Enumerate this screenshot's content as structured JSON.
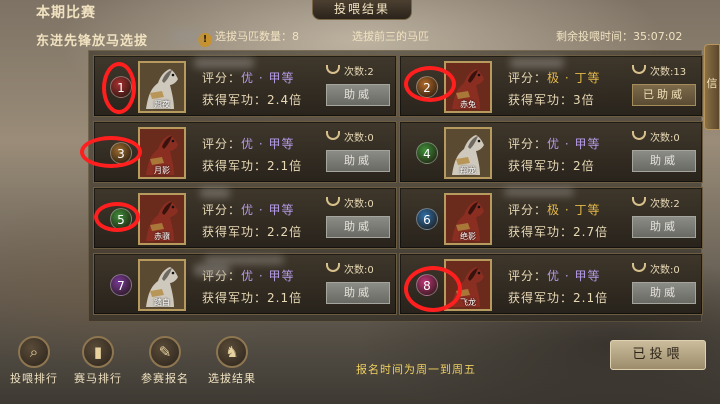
{
  "header": {
    "period_title": "本期比赛",
    "event_name": "东进先锋放马选拔",
    "tab_title": "投喂结果",
    "select_count_label": "选拔马匹数量：8",
    "select_top_label": "选拔前三的马匹",
    "remaining_label": "剩余投喂时间：35:07:02"
  },
  "cards": [
    {
      "rank": "1",
      "horse": "照夜",
      "rating_label": "评分：",
      "grade_a": "优",
      "grade_b": "甲等",
      "merit_label": "获得军功：",
      "merit": "2.4倍",
      "count": "次数:2",
      "button": "助威",
      "done": false,
      "badge_color": "#a83030"
    },
    {
      "rank": "2",
      "horse": "赤兔",
      "rating_label": "评分：",
      "grade_a": "极",
      "grade_b": "丁等",
      "merit_label": "获得军功：",
      "merit": "3倍",
      "count": "次数:13",
      "button": "已助威",
      "done": true,
      "badge_color": "#b36a2a"
    },
    {
      "rank": "3",
      "horse": "月影",
      "rating_label": "评分：",
      "grade_a": "优",
      "grade_b": "甲等",
      "merit_label": "获得军功：",
      "merit": "2.1倍",
      "count": "次数:0",
      "button": "助威",
      "done": false,
      "badge_color": "#9a6a2e"
    },
    {
      "rank": "4",
      "horse": "翔龙",
      "rating_label": "评分：",
      "grade_a": "优",
      "grade_b": "甲等",
      "merit_label": "获得军功：",
      "merit": "2倍",
      "count": "次数:0",
      "button": "助威",
      "done": false,
      "badge_color": "#3f8f3a"
    },
    {
      "rank": "5",
      "horse": "赤骥",
      "rating_label": "评分：",
      "grade_a": "优",
      "grade_b": "甲等",
      "merit_label": "获得军功：",
      "merit": "2.2倍",
      "count": "次数:0",
      "button": "助威",
      "done": false,
      "badge_color": "#3f8f3a"
    },
    {
      "rank": "6",
      "horse": "绝影",
      "rating_label": "评分：",
      "grade_a": "极",
      "grade_b": "丁等",
      "merit_label": "获得军功：",
      "merit": "2.7倍",
      "count": "次数:2",
      "button": "助威",
      "done": false,
      "badge_color": "#2f6fa8"
    },
    {
      "rank": "7",
      "horse": "踏白",
      "rating_label": "评分：",
      "grade_a": "优",
      "grade_b": "甲等",
      "merit_label": "获得军功：",
      "merit": "2.1倍",
      "count": "次数:0",
      "button": "助威",
      "done": false,
      "badge_color": "#7b3a9a"
    },
    {
      "rank": "8",
      "horse": "飞龙",
      "rating_label": "评分：",
      "grade_a": "优",
      "grade_b": "甲等",
      "merit_label": "获得军功：",
      "merit": "2.1倍",
      "count": "次数:0",
      "button": "助威",
      "done": false,
      "badge_color": "#c0367a"
    }
  ],
  "side_tab": "信",
  "nav": [
    {
      "label": "投喂排行",
      "icon": "magnifier-icon"
    },
    {
      "label": "赛马排行",
      "icon": "bar-chart-icon"
    },
    {
      "label": "参赛报名",
      "icon": "signup-icon"
    },
    {
      "label": "选拔结果",
      "icon": "result-icon"
    }
  ],
  "footer_note": "报名时间为周一到周五",
  "final_button": "已投喂"
}
